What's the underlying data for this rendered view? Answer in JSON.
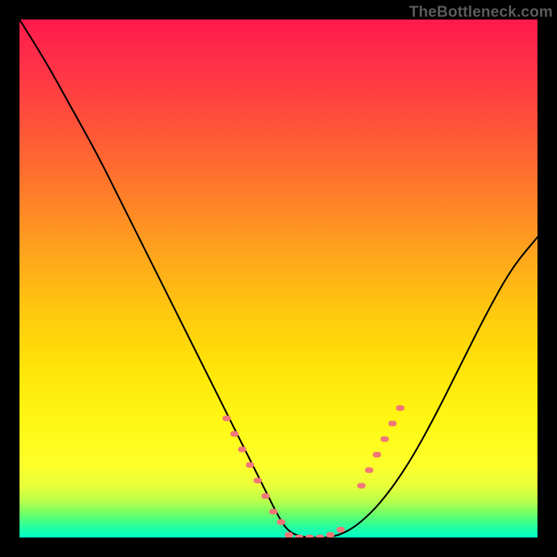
{
  "watermark": "TheBottleneck.com",
  "colors": {
    "background": "#000000",
    "gradient_top": "#ff1a4b",
    "gradient_mid": "#fff814",
    "gradient_bottom": "#00ffc8",
    "curve": "#000000",
    "marker": "#f07777"
  },
  "chart_data": {
    "type": "line",
    "title": "",
    "xlabel": "",
    "ylabel": "",
    "xlim": [
      0,
      100
    ],
    "ylim": [
      0,
      100
    ],
    "grid": false,
    "series": [
      {
        "name": "curve",
        "x": [
          0,
          5,
          10,
          15,
          20,
          25,
          30,
          35,
          40,
          45,
          48,
          50,
          52,
          55,
          58,
          60,
          63,
          66,
          70,
          75,
          80,
          85,
          90,
          95,
          100
        ],
        "y": [
          100,
          92,
          83,
          74,
          64,
          54,
          44,
          34,
          24,
          14,
          8,
          4,
          1,
          0,
          0,
          0,
          1,
          3,
          7,
          14,
          23,
          33,
          43,
          52,
          58
        ]
      }
    ],
    "markers": [
      {
        "name": "left-cluster",
        "x": [
          40,
          41.5,
          43,
          44.5,
          46,
          47.5,
          49,
          50.5
        ],
        "y": [
          23,
          20,
          17,
          14,
          11,
          8,
          5,
          3
        ]
      },
      {
        "name": "valley-cluster",
        "x": [
          52,
          54,
          56,
          58,
          60,
          62
        ],
        "y": [
          0.5,
          0,
          0,
          0,
          0.5,
          1.5
        ]
      },
      {
        "name": "right-cluster",
        "x": [
          66,
          67.5,
          69,
          70.5,
          72,
          73.5
        ],
        "y": [
          10,
          13,
          16,
          19,
          22,
          25
        ]
      }
    ],
    "annotations": []
  }
}
